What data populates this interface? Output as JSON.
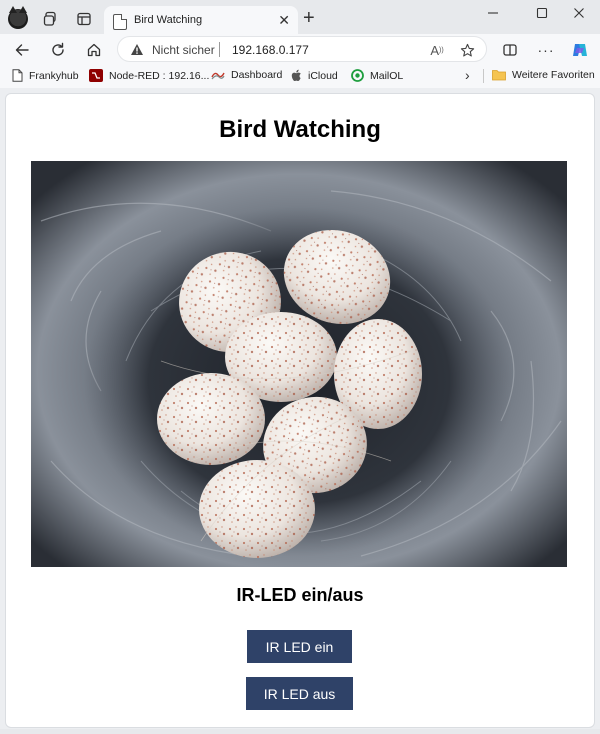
{
  "browser": {
    "tab": {
      "title": "Bird Watching"
    },
    "address": {
      "security_label": "Nicht sicher",
      "url": "192.168.0.177"
    },
    "favorites": [
      {
        "label": "Frankyhub",
        "icon": "document-icon"
      },
      {
        "label": "Node-RED : 192.16...",
        "icon": "node-red-icon"
      },
      {
        "label": "Dashboard",
        "icon": "dashboard-icon"
      },
      {
        "label": "iCloud",
        "icon": "apple-icon"
      },
      {
        "label": "MailOL",
        "icon": "mail-icon"
      }
    ],
    "other_favorites": {
      "label": "Weitere Favoriten",
      "icon": "folder-icon"
    }
  },
  "page": {
    "title": "Bird Watching",
    "image": {
      "subject": "bird-nest-with-speckled-eggs"
    },
    "section_heading": "IR-LED ein/aus",
    "buttons": {
      "led_on": "IR LED ein",
      "led_off": "IR LED aus"
    }
  },
  "colors": {
    "button_bg": "#2f4268",
    "button_text": "#ffffff",
    "page_bg": "#ffffff",
    "chrome_bg": "#e7e9ec"
  }
}
